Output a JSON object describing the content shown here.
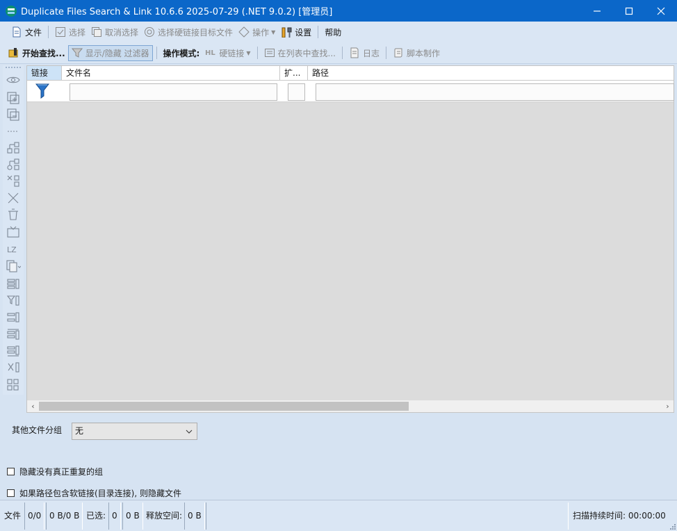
{
  "window": {
    "title": "Duplicate Files Search & Link 10.6.6 2025-07-29 (.NET 9.0.2) [管理员]",
    "controls": [
      "minimize",
      "maximize",
      "close"
    ]
  },
  "toolbar1": {
    "items": [
      {
        "label": "文件",
        "icon": "document-icon",
        "enabled": true
      },
      {
        "label": "选择",
        "icon": "checkbox-icon",
        "enabled": false
      },
      {
        "label": "取消选择",
        "icon": "deselect-icon",
        "enabled": false
      },
      {
        "label": "选择硬链接目标文件",
        "icon": "target-icon",
        "enabled": false
      },
      {
        "label": "操作",
        "icon": "diamond-icon",
        "enabled": false
      },
      {
        "label": "设置",
        "icon": "tools-icon",
        "enabled": true
      },
      {
        "label": "帮助",
        "icon": "",
        "enabled": true
      }
    ]
  },
  "toolbar2": {
    "start_search": "开始查找...",
    "toggle_filter": "显示/隐藏 过滤器",
    "mode_label": "操作模式:",
    "hardlink": "硬链接",
    "find_in_list": "在列表中查找...",
    "log": "日志",
    "script": "脚本制作"
  },
  "grid": {
    "columns": [
      "链接",
      "文件名",
      "扩...",
      "路径"
    ],
    "active_column": "链接"
  },
  "grouping": {
    "label": "其他文件分组",
    "selected": "无"
  },
  "options": [
    {
      "label": "隐藏没有真正重复的组",
      "checked": false
    },
    {
      "label": "如果路径包含软链接(目录连接), 则隐藏文件",
      "checked": false
    }
  ],
  "status": {
    "files_label": "文件",
    "files_count": "0/0",
    "files_size": "0 B/0 B",
    "selected_label": "已选:",
    "selected_count": "0",
    "selected_size": "0 B",
    "free_label": "释放空间:",
    "free_size": "0 B",
    "duration_label": "扫描持续时间:",
    "duration": "00:00:00"
  },
  "colors": {
    "titlebar": "#0b67c9",
    "toolbar_bg": "#dae6f4",
    "grid_bg": "#dcdcdc"
  }
}
